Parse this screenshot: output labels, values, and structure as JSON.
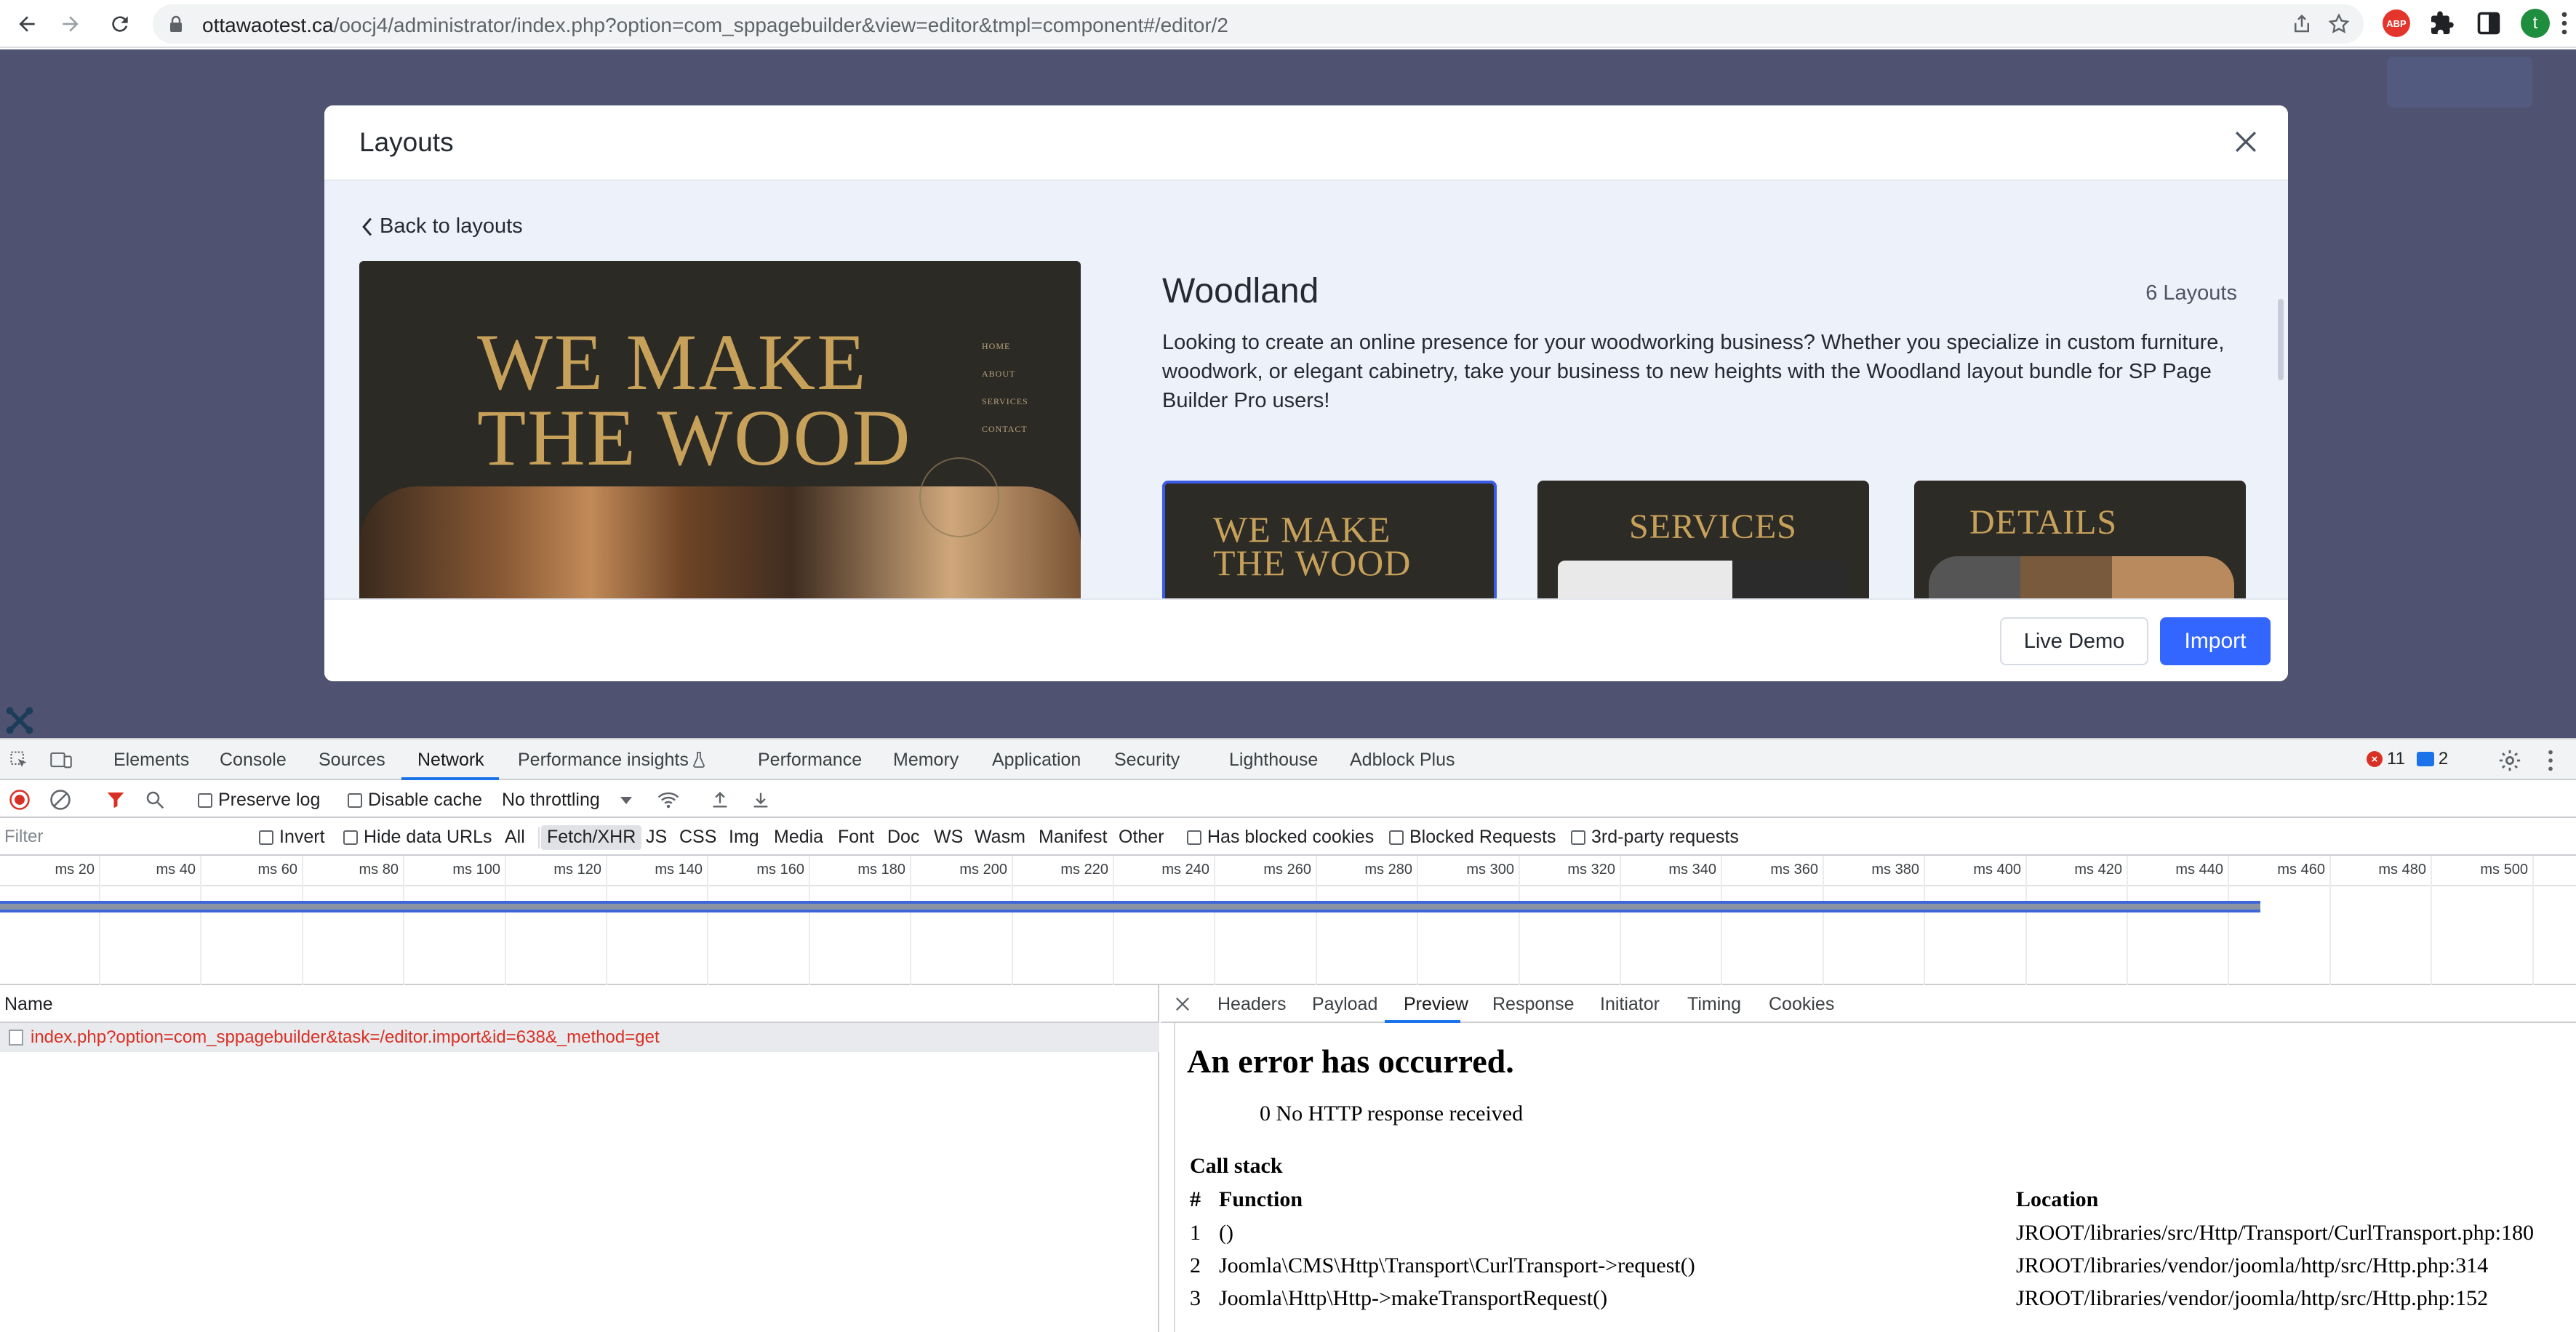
{
  "browser": {
    "url_host": "ottawaotest.ca",
    "url_path": "/oocj4/administrator/index.php?option=com_sppagebuilder&view=editor&tmpl=component#/editor/2",
    "extension_abp_label": "ABP",
    "profile_initial": "t"
  },
  "modal": {
    "title": "Layouts",
    "back_label": "Back to layouts",
    "layout_name": "Woodland",
    "layout_count": "6 Layouts",
    "description": "Looking to create an online presence for your woodworking business? Whether you specialize in custom furniture, woodwork, or elegant cabinetry, take your business to new heights with the Woodland layout bundle for SP Page Builder Pro users!",
    "preview": {
      "headline_line1": "WE MAKE",
      "headline_line2": "THE WOOD",
      "nav": [
        "HOME",
        "ABOUT",
        "SERVICES",
        "CONTACT"
      ]
    },
    "thumbnails": [
      {
        "line1": "WE MAKE",
        "line2": "THE WOOD"
      },
      {
        "line1": "SERVICES"
      },
      {
        "line1": "DETAILS"
      }
    ],
    "live_demo_label": "Live Demo",
    "import_label": "Import"
  },
  "devtools": {
    "tabs": [
      "Elements",
      "Console",
      "Sources",
      "Network",
      "Performance insights",
      "Performance",
      "Memory",
      "Application",
      "Security",
      "Lighthouse",
      "Adblock Plus"
    ],
    "active_tab": "Network",
    "error_count": "11",
    "message_count": "2",
    "toolbar": {
      "preserve_log": "Preserve log",
      "disable_cache": "Disable cache",
      "throttling": "No throttling"
    },
    "filterbar": {
      "placeholder": "Filter",
      "invert": "Invert",
      "hide_data_urls": "Hide data URLs",
      "types": [
        "All",
        "Fetch/XHR",
        "JS",
        "CSS",
        "Img",
        "Media",
        "Font",
        "Doc",
        "WS",
        "Wasm",
        "Manifest",
        "Other"
      ],
      "active_type": "Fetch/XHR",
      "has_blocked_cookies": "Has blocked cookies",
      "blocked_requests": "Blocked Requests",
      "third_party": "3rd-party requests"
    },
    "timeline_ticks": [
      "20 ms",
      "40 ms",
      "60 ms",
      "80 ms",
      "100 ms",
      "120 ms",
      "140 ms",
      "160 ms",
      "180 ms",
      "200 ms",
      "220 ms",
      "240 ms",
      "260 ms",
      "280 ms",
      "300 ms",
      "320 ms",
      "340 ms",
      "360 ms",
      "380 ms",
      "400 ms",
      "420 ms",
      "440 ms",
      "460 ms",
      "480 ms",
      "500 ms"
    ],
    "name_header": "Name",
    "request_name": "index.php?option=com_sppagebuilder&task=/editor.import&id=638&_method=get",
    "detail_tabs": [
      "Headers",
      "Payload",
      "Preview",
      "Response",
      "Initiator",
      "Timing",
      "Cookies"
    ],
    "active_detail_tab": "Preview",
    "preview": {
      "error_title": "An error has occurred.",
      "error_message": "0 No HTTP response received",
      "callstack_title": "Call stack",
      "header_num": "#",
      "header_function": "Function",
      "header_location": "Location",
      "rows": [
        {
          "num": "1",
          "fn": "()",
          "loc": "JROOT/libraries/src/Http/Transport/CurlTransport.php:180"
        },
        {
          "num": "2",
          "fn": "Joomla\\CMS\\Http\\Transport\\CurlTransport->request()",
          "loc": "JROOT/libraries/vendor/joomla/http/src/Http.php:314"
        },
        {
          "num": "3",
          "fn": "Joomla\\Http\\Http->makeTransportRequest()",
          "loc": "JROOT/libraries/vendor/joomla/http/src/Http.php:152"
        }
      ]
    }
  },
  "colors": {
    "accent": "#3366ff",
    "devtools_blue": "#1a73e8",
    "error_red": "#d93025",
    "overlay": "#4f5270",
    "wood_gold": "#c7a15a"
  }
}
